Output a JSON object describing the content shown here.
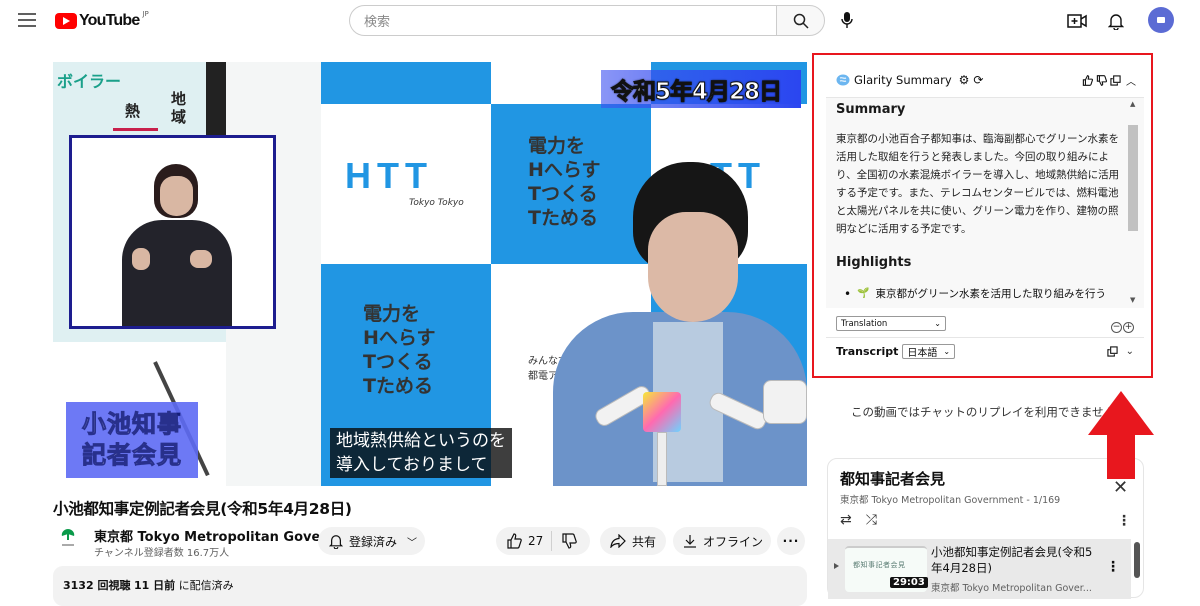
{
  "header": {
    "logo_text": "YouTube",
    "logo_region": "JP",
    "search_placeholder": "検索",
    "icons": [
      "menu-icon",
      "search-icon",
      "mic-icon",
      "create-icon",
      "bell-icon",
      "avatar"
    ]
  },
  "video": {
    "date_overlay": "令和5年4月28日",
    "title_card": [
      "小池知事",
      "記者会見"
    ],
    "caption": [
      "地域熱供給というのを",
      "導入しておりまして"
    ],
    "slide_heading": "ボイラー",
    "slide_word1": "熱",
    "slide_word2": "地域",
    "poster_htt": "HTT",
    "poster_htt_sub": "Tokyo Tokyo",
    "poster_lines": [
      "電力を",
      "Hへらす",
      "Tつくる",
      "Tためる"
    ],
    "poster_small": [
      "みんなで",
      "都電アクシ"
    ]
  },
  "below_video": {
    "title": "小池都知事定例記者会見(令和5年4月28日)",
    "channel_name": "東京都 Tokyo Metropolitan Govern...",
    "channel_subs": "チャンネル登録者数 16.7万人",
    "subscribe_label": "登録済み",
    "like_count": "27",
    "share_label": "共有",
    "download_label": "オフライン",
    "more_label": "···",
    "views": "3132 回視聴",
    "published_bold": "11 日前",
    "published_suffix": "に配信済み"
  },
  "glarity": {
    "title": "Glarity Summary",
    "summary_heading": "Summary",
    "summary_text": "東京都の小池百合子都知事は、臨海副都心でグリーン水素を活用した取組を行うと発表しました。今回の取り組みにより、全国初の水素混焼ボイラーを導入し、地域熱供給に活用する予定です。また、テレコムセンタービルでは、燃料電池と太陽光パネルを共に使い、グリーン電力を作り、建物の照明などに活用する予定です。",
    "highlights_heading": "Highlights",
    "highlights": [
      {
        "emoji": "🌱",
        "text": "東京都がグリーン水素を活用した取り組みを行う"
      }
    ],
    "translation_select": "Translation",
    "transcript_label": "Transcript",
    "transcript_lang": "日本語"
  },
  "chat": {
    "message": "この動画ではチャットのリプレイを利用できません。"
  },
  "playlist": {
    "title": "都知事記者会見",
    "subtitle": "東京都 Tokyo Metropolitan Government - 1/169",
    "items": [
      {
        "thumb_text": "都知事記者会見",
        "duration": "29:03",
        "title": "小池都知事定例記者会見(令和5年4月28日)",
        "channel": "東京都 Tokyo Metropolitan Gover..."
      }
    ]
  },
  "annotation": {
    "frame_color": "#e8171e",
    "arrow_color": "#e8171e"
  }
}
